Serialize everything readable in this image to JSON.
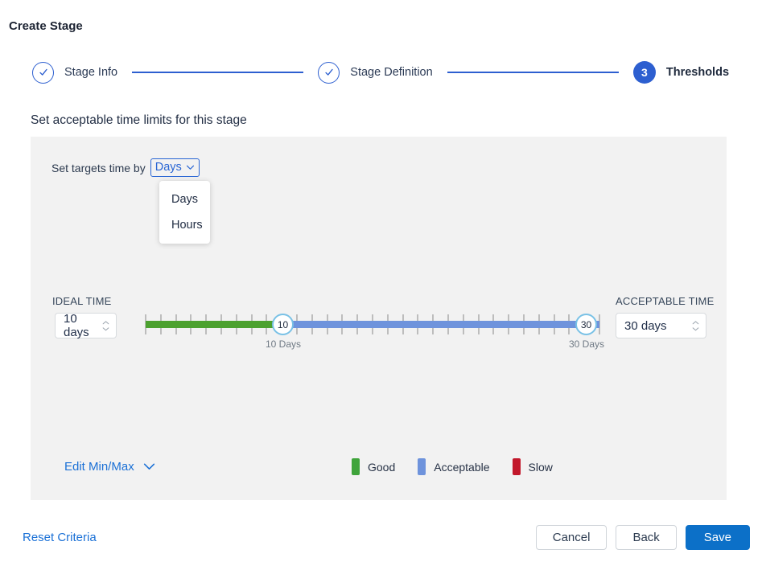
{
  "title": "Create Stage",
  "stepper": {
    "steps": [
      {
        "label": "Stage Info",
        "state": "complete"
      },
      {
        "label": "Stage Definition",
        "state": "complete"
      },
      {
        "label": "Thresholds",
        "state": "current",
        "number": "3"
      }
    ]
  },
  "section_title": "Set acceptable time limits for this stage",
  "panel": {
    "targets_label": "Set targets time by",
    "unit_dropdown": {
      "value": "Days",
      "options": [
        "Days",
        "Hours"
      ]
    },
    "ideal": {
      "label": "IDEAL TIME",
      "value": "10 days"
    },
    "acceptable": {
      "label": "ACCEPTABLE TIME",
      "value": "30 days"
    },
    "slider": {
      "ticks": 31,
      "handle_min_value": "10",
      "handle_max_value": "30",
      "min_label": "10 Days",
      "max_label": "30 Days",
      "colors": {
        "good": "#4ca12f",
        "acceptable": "#6e93dc",
        "handle_ring": "#79c1e6",
        "tick": "#bdbdbd"
      }
    },
    "edit_minmax_label": "Edit Min/Max",
    "legend": [
      {
        "label": "Good",
        "color": "#3fa43b"
      },
      {
        "label": "Acceptable",
        "color": "#6e93dc"
      },
      {
        "label": "Slow",
        "color": "#c2182b"
      }
    ]
  },
  "footer": {
    "reset_label": "Reset Criteria",
    "cancel_label": "Cancel",
    "back_label": "Back",
    "save_label": "Save"
  },
  "colors": {
    "accent_blue": "#2d5fd0",
    "link_blue": "#1a70d6",
    "save_blue": "#0c70c8",
    "panel_bg": "#f2f2f2"
  }
}
